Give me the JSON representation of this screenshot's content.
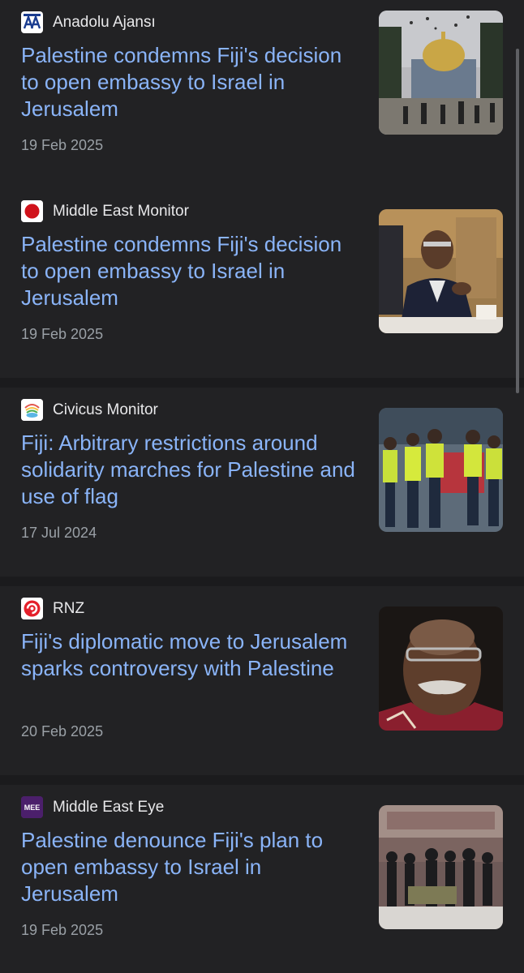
{
  "articles": [
    {
      "source": "Anadolu Ajansı",
      "logo_icon": "anadolu-agency-logo",
      "headline": "Palestine condemns Fiji's decision to open embassy to Israel in Jerusalem",
      "date": "19 Feb 2025",
      "thumbnail_icon": "dome-of-the-rock-photo"
    },
    {
      "source": "Middle East Monitor",
      "logo_icon": "middle-east-monitor-logo",
      "headline": "Palestine condemns Fiji's decision to open embassy to Israel in Jerusalem",
      "date": "19 Feb 2025",
      "thumbnail_icon": "official-seated-photo"
    },
    {
      "source": "Civicus Monitor",
      "logo_icon": "civicus-monitor-logo",
      "headline": "Fiji: Arbitrary restrictions around solidarity marches for Palestine and use of flag",
      "date": "17 Jul 2024",
      "thumbnail_icon": "police-officers-photo"
    },
    {
      "source": "RNZ",
      "logo_icon": "rnz-logo",
      "headline": "Fiji's diplomatic move to Jerusalem sparks controversy with Palestine",
      "date": "20 Feb 2025",
      "thumbnail_icon": "portrait-photo"
    },
    {
      "source": "Middle East Eye",
      "logo_icon": "middle-east-eye-logo",
      "headline": "Palestine denounce Fiji's plan to open embassy to Israel in Jerusalem",
      "date": "19 Feb 2025",
      "thumbnail_icon": "rally-crowd-photo"
    }
  ],
  "colors": {
    "background": "#1b1b1d",
    "card": "#222224",
    "headline": "#8ab4f8",
    "source_text": "#e8e8ea",
    "date_text": "#9aa0a6"
  }
}
